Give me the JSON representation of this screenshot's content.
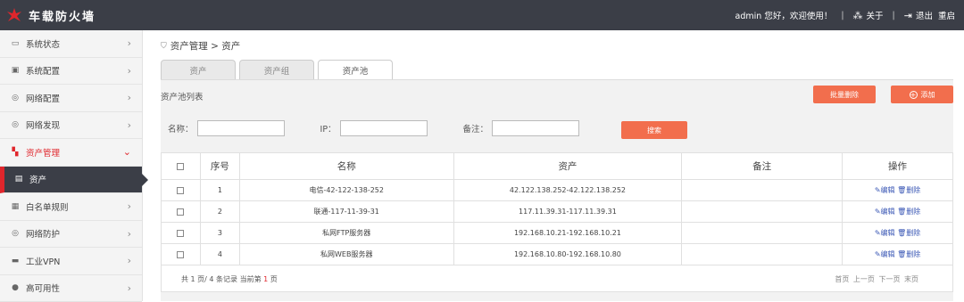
{
  "app": {
    "title": "车载防火墙"
  },
  "topbar": {
    "greeting": "admin 您好，欢迎使用！",
    "sep": "|",
    "about": "关于",
    "logout": "退出",
    "restart": "重启"
  },
  "sidebar": {
    "items": [
      {
        "label": "系统状态",
        "icon": "monitor-icon"
      },
      {
        "label": "系统配置",
        "icon": "settings-monitor-icon"
      },
      {
        "label": "网络配置",
        "icon": "globe-icon"
      },
      {
        "label": "网络发现",
        "icon": "globe-icon"
      },
      {
        "label": "资产管理",
        "icon": "grid-icon"
      },
      {
        "label": "资产",
        "icon": "list-icon"
      },
      {
        "label": "白名单规则",
        "icon": "document-icon"
      },
      {
        "label": "网络防护",
        "icon": "globe-icon"
      },
      {
        "label": "工业VPN",
        "icon": "vpn-icon"
      },
      {
        "label": "高可用性",
        "icon": "database-icon"
      }
    ]
  },
  "breadcrumb": "资产管理 > 资产",
  "tabs": [
    {
      "label": "资产",
      "active": false
    },
    {
      "label": "资产组",
      "active": false
    },
    {
      "label": "资产池",
      "active": true
    }
  ],
  "panel": {
    "title": "资产池列表",
    "batch_delete": "批量删除",
    "add": "添加"
  },
  "filters": {
    "name_label": "名称：",
    "ip_label": "IP：",
    "note_label": "备注：",
    "search": "搜索"
  },
  "table": {
    "headers": [
      "序号",
      "名称",
      "资产",
      "备注",
      "操作"
    ],
    "rows": [
      {
        "index": "1",
        "name": "电信-42-122-138-252",
        "asset": "42.122.138.252-42.122.138.252",
        "note": ""
      },
      {
        "index": "2",
        "name": "联通-117-11-39-31",
        "asset": "117.11.39.31-117.11.39.31",
        "note": ""
      },
      {
        "index": "3",
        "name": "私网FTP服务器",
        "asset": "192.168.10.21-192.168.10.21",
        "note": ""
      },
      {
        "index": "4",
        "name": "私网WEB服务器",
        "asset": "192.168.10.80-192.168.10.80",
        "note": ""
      }
    ],
    "edit": "编辑",
    "delete": "删除"
  },
  "pagination": {
    "summary_prefix": "共 1 页/ 4 条记录 当前第",
    "current": "1",
    "summary_suffix": "页",
    "first": "首页",
    "prev": "上一页",
    "next": "下一页",
    "last": "末页"
  },
  "colors": {
    "accent": "#f26e4d",
    "brand_red": "#e0262c",
    "topbar": "#3b3e47"
  }
}
